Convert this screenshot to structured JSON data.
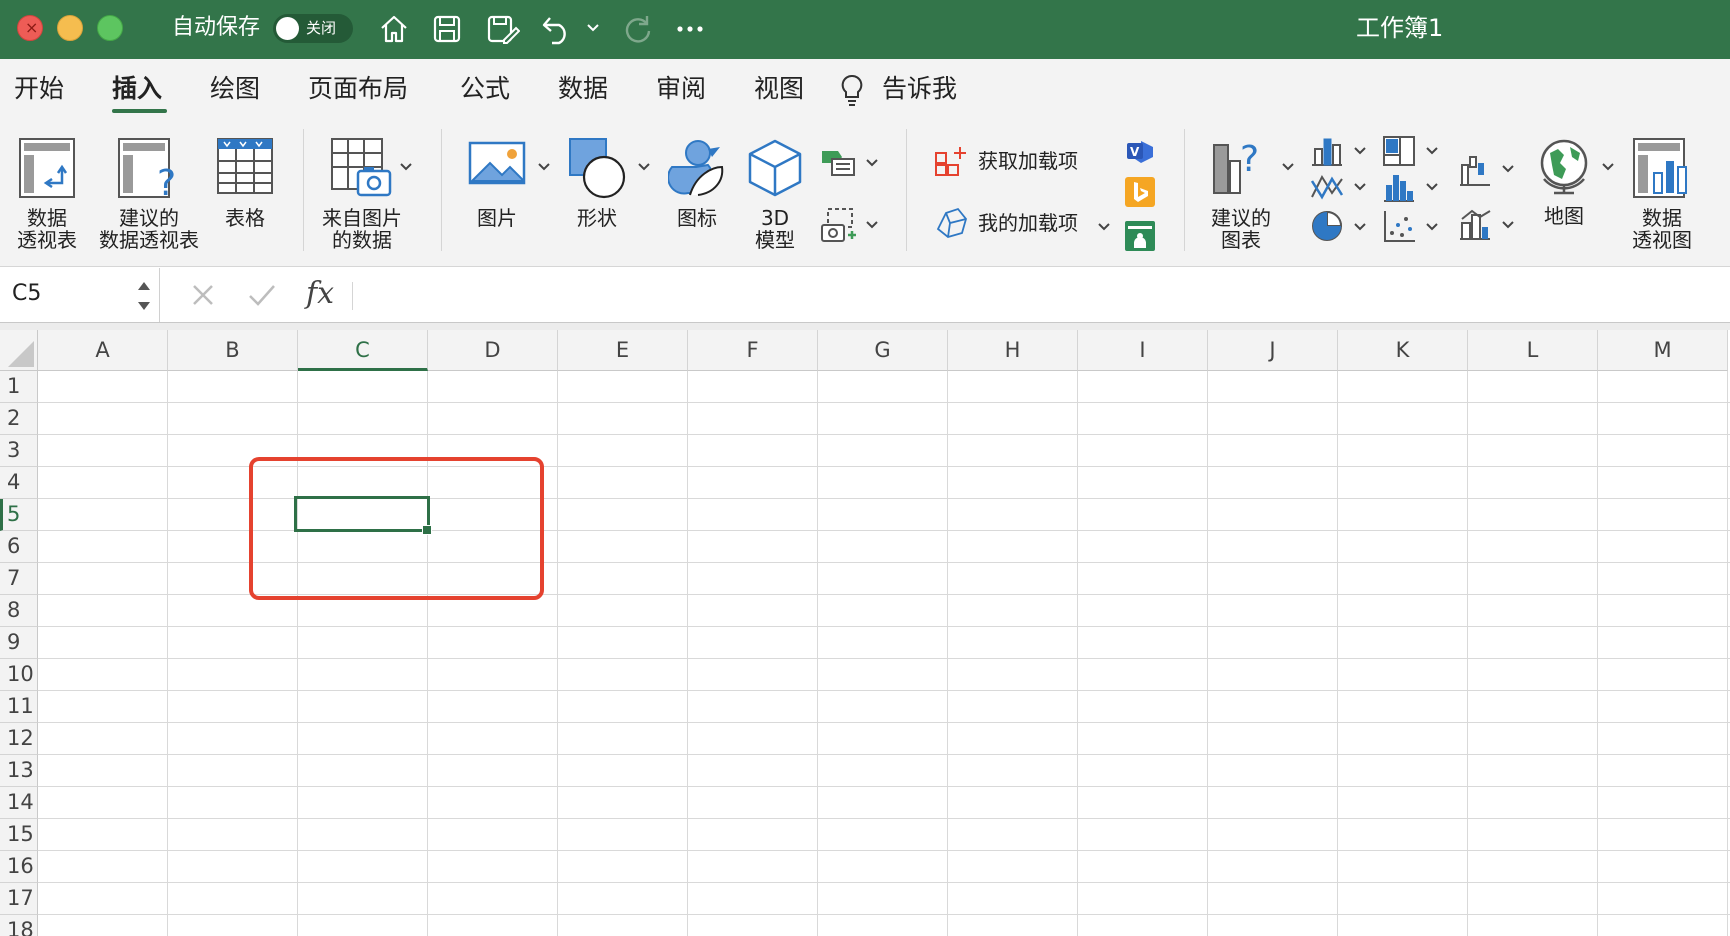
{
  "titlebar": {
    "autosave_label": "自动保存",
    "autosave_state": "关闭",
    "doc_title": "工作簿1",
    "bg_color": "#33754a",
    "icons": [
      "home-icon",
      "save-icon",
      "save-as-icon",
      "undo-icon",
      "redo-icon",
      "more-icon"
    ]
  },
  "tabs": [
    {
      "label": "开始"
    },
    {
      "label": "插入",
      "active": true
    },
    {
      "label": "绘图"
    },
    {
      "label": "页面布局"
    },
    {
      "label": "公式"
    },
    {
      "label": "数据"
    },
    {
      "label": "审阅"
    },
    {
      "label": "视图"
    }
  ],
  "tell_me": "告诉我",
  "ribbon": {
    "pivot_table": [
      "数据",
      "透视表"
    ],
    "recommended_pivot": [
      "建议的",
      "数据透视表"
    ],
    "table": "表格",
    "from_picture": [
      "来自图片",
      "的数据"
    ],
    "pictures": "图片",
    "shapes": "形状",
    "icons": "图标",
    "model_3d": [
      "3D",
      "模型"
    ],
    "get_addins": "获取加载项",
    "my_addins": "我的加载项",
    "recommended_charts": [
      "建议的",
      "图表"
    ],
    "map": "地图",
    "pivot_chart": [
      "数据",
      "透视图"
    ]
  },
  "formula_bar": {
    "name_box": "C5",
    "fx": "fx",
    "formula": ""
  },
  "grid": {
    "columns": [
      "A",
      "B",
      "C",
      "D",
      "E",
      "F",
      "G",
      "H",
      "I",
      "J",
      "K",
      "L",
      "M"
    ],
    "rows": [
      "1",
      "2",
      "3",
      "4",
      "5",
      "6",
      "7",
      "8",
      "9",
      "10",
      "11",
      "12",
      "13",
      "14",
      "15",
      "16",
      "17",
      "18"
    ],
    "selected_column": "C",
    "selected_row": "5",
    "accent_color": "#2e7047",
    "annotation_color": "#e5422f"
  }
}
